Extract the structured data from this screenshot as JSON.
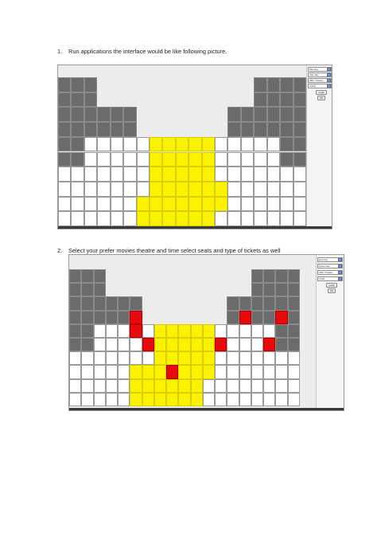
{
  "steps": [
    {
      "number": "1.",
      "text": "Run applications the interface would be like following picture."
    },
    {
      "number": "2.",
      "text": "Select your prefer movies theatre and time select seats and type of tickets as well"
    }
  ],
  "screens": [
    {
      "controls": {
        "time_select": "Morning",
        "movie_select": "Star War",
        "theatre_select": "ABC Theatre",
        "ticket_select": "Adults",
        "load_button": "Load",
        "ok_button": "OK"
      },
      "seats": {
        "columns": 19,
        "rows": [
          [
            "g",
            "g",
            "g",
            "",
            "",
            "",
            "",
            "",
            "",
            "",
            "",
            "",
            "",
            "",
            "",
            "g",
            "g",
            "g",
            "g"
          ],
          [
            "g",
            "g",
            "g",
            "",
            "",
            "",
            "",
            "",
            "",
            "",
            "",
            "",
            "",
            "",
            "",
            "g",
            "g",
            "g",
            "g"
          ],
          [
            "g",
            "g",
            "g",
            "g",
            "g",
            "g",
            "",
            "",
            "",
            "",
            "",
            "",
            "",
            "g",
            "g",
            "g",
            "g",
            "g",
            "g"
          ],
          [
            "g",
            "g",
            "g",
            "g",
            "g",
            "g",
            "",
            "",
            "",
            "",
            "",
            "",
            "",
            "g",
            "g",
            "g",
            "g",
            "g",
            "g"
          ],
          [
            "g",
            "g",
            "w",
            "w",
            "w",
            "w",
            "w",
            "y",
            "y",
            "y",
            "y",
            "y",
            "w",
            "w",
            "w",
            "w",
            "w",
            "g",
            "g"
          ],
          [
            "g",
            "g",
            "w",
            "w",
            "w",
            "w",
            "w",
            "y",
            "y",
            "y",
            "y",
            "y",
            "w",
            "w",
            "w",
            "w",
            "w",
            "g",
            "g"
          ],
          [
            "w",
            "w",
            "w",
            "w",
            "w",
            "w",
            "w",
            "y",
            "y",
            "y",
            "y",
            "y",
            "w",
            "w",
            "w",
            "w",
            "w",
            "w",
            "w"
          ],
          [
            "w",
            "w",
            "w",
            "w",
            "w",
            "w",
            "w",
            "y",
            "y",
            "y",
            "y",
            "y",
            "y",
            "w",
            "w",
            "w",
            "w",
            "w",
            "w"
          ],
          [
            "w",
            "w",
            "w",
            "w",
            "w",
            "w",
            "y",
            "y",
            "y",
            "y",
            "y",
            "y",
            "y",
            "w",
            "w",
            "w",
            "w",
            "w",
            "w"
          ],
          [
            "w",
            "w",
            "w",
            "w",
            "w",
            "w",
            "y",
            "y",
            "y",
            "y",
            "y",
            "y",
            "w",
            "w",
            "w",
            "w",
            "w",
            "w",
            "w"
          ]
        ]
      }
    },
    {
      "controls": {
        "time_select": "Evening",
        "movie_select": "Superman",
        "theatre_select": "ABC Theatre",
        "ticket_select": "Child",
        "load_button": "Load",
        "ok_button": "OK"
      },
      "seats": {
        "columns": 19,
        "rows": [
          [
            "g",
            "g",
            "g",
            "",
            "",
            "",
            "",
            "",
            "",
            "",
            "",
            "",
            "",
            "",
            "",
            "g",
            "g",
            "g",
            "g"
          ],
          [
            "g",
            "g",
            "g",
            "",
            "",
            "",
            "",
            "",
            "",
            "",
            "",
            "",
            "",
            "",
            "",
            "g",
            "g",
            "g",
            "g"
          ],
          [
            "g",
            "g",
            "g",
            "g",
            "g",
            "g",
            "",
            "",
            "",
            "",
            "",
            "",
            "",
            "g",
            "g",
            "g",
            "g",
            "g",
            "g"
          ],
          [
            "g",
            "g",
            "g",
            "g",
            "g",
            "r",
            "",
            "",
            "",
            "",
            "",
            "",
            "",
            "g",
            "r",
            "g",
            "g",
            "r",
            "g"
          ],
          [
            "g",
            "g",
            "w",
            "w",
            "w",
            "r",
            "w",
            "y",
            "y",
            "y",
            "y",
            "y",
            "w",
            "w",
            "w",
            "w",
            "w",
            "g",
            "g"
          ],
          [
            "g",
            "g",
            "w",
            "w",
            "w",
            "w",
            "r",
            "y",
            "y",
            "y",
            "y",
            "y",
            "r",
            "w",
            "w",
            "w",
            "r",
            "g",
            "g"
          ],
          [
            "w",
            "w",
            "w",
            "w",
            "w",
            "w",
            "w",
            "y",
            "y",
            "y",
            "y",
            "y",
            "w",
            "w",
            "w",
            "w",
            "w",
            "w",
            "w"
          ],
          [
            "w",
            "w",
            "w",
            "w",
            "w",
            "y",
            "y",
            "y",
            "r",
            "y",
            "y",
            "y",
            "w",
            "w",
            "w",
            "w",
            "w",
            "w",
            "w"
          ],
          [
            "w",
            "w",
            "w",
            "w",
            "w",
            "y",
            "y",
            "y",
            "y",
            "y",
            "y",
            "w",
            "w",
            "w",
            "w",
            "w",
            "w",
            "w",
            "w"
          ],
          [
            "w",
            "w",
            "w",
            "w",
            "w",
            "y",
            "y",
            "y",
            "y",
            "y",
            "y",
            "w",
            "w",
            "w",
            "w",
            "w",
            "w",
            "w",
            "w"
          ]
        ]
      }
    }
  ]
}
